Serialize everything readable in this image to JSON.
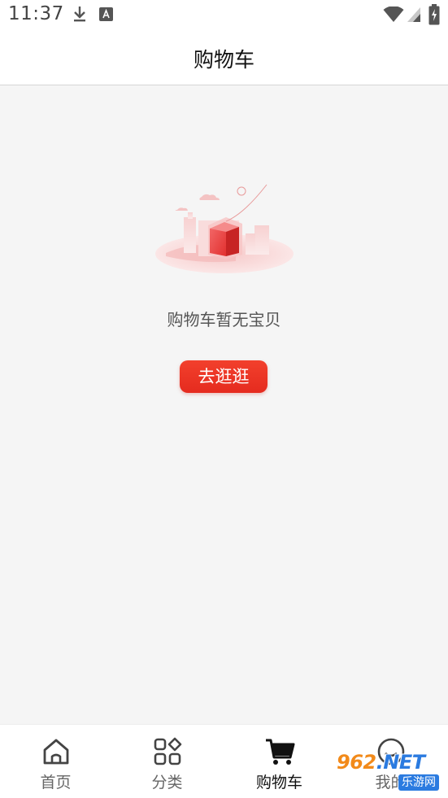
{
  "status_bar": {
    "time": "11:37"
  },
  "header": {
    "title": "购物车"
  },
  "empty_state": {
    "message": "购物车暂无宝贝",
    "button_label": "去逛逛"
  },
  "tabs": [
    {
      "label": "首页",
      "icon": "home-icon",
      "active": false
    },
    {
      "label": "分类",
      "icon": "category-grid-icon",
      "active": false
    },
    {
      "label": "购物车",
      "icon": "cart-icon",
      "active": true
    },
    {
      "label": "我的",
      "icon": "profile-icon",
      "active": false
    }
  ],
  "watermark": {
    "top": "962",
    "top_suffix": ".NET",
    "bottom": "乐游网"
  },
  "colors": {
    "accent": "#e52b1f",
    "content_bg": "#f5f5f5"
  }
}
